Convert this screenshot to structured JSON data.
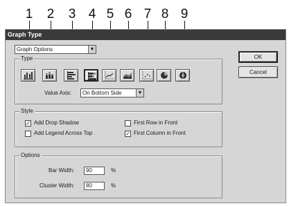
{
  "callouts": [
    "1",
    "2",
    "3",
    "4",
    "5",
    "6",
    "7",
    "8",
    "9"
  ],
  "window": {
    "title": "Graph Type"
  },
  "panel_select": {
    "value": "Graph Options"
  },
  "type_group": {
    "label": "Type",
    "buttons": [
      {
        "icon": "grouped-column-graph-icon"
      },
      {
        "icon": "stacked-column-graph-icon"
      },
      {
        "icon": "bar-graph-icon"
      },
      {
        "icon": "stacked-bar-graph-icon"
      },
      {
        "icon": "line-graph-icon"
      },
      {
        "icon": "area-graph-icon"
      },
      {
        "icon": "scatter-graph-icon"
      },
      {
        "icon": "pie-graph-icon"
      },
      {
        "icon": "radar-graph-icon"
      }
    ],
    "selected_index": 3,
    "value_axis": {
      "label": "Value Axis:",
      "value": "On Bottom Side"
    }
  },
  "style_group": {
    "label": "Style",
    "add_drop_shadow": {
      "label": "Add Drop Shadow",
      "checked": true
    },
    "add_legend": {
      "label": "Add Legend Across Top",
      "checked": false
    },
    "first_row": {
      "label": "First Row in Front",
      "checked": false
    },
    "first_column": {
      "label": "First Column in Front",
      "checked": true
    }
  },
  "options_group": {
    "label": "Options",
    "bar_width": {
      "label": "Bar Width:",
      "value": "90",
      "unit": "%"
    },
    "cluster_width": {
      "label": "Cluster Width:",
      "value": "80",
      "unit": "%"
    }
  },
  "buttons": {
    "ok": "OK",
    "cancel": "Cancel"
  }
}
